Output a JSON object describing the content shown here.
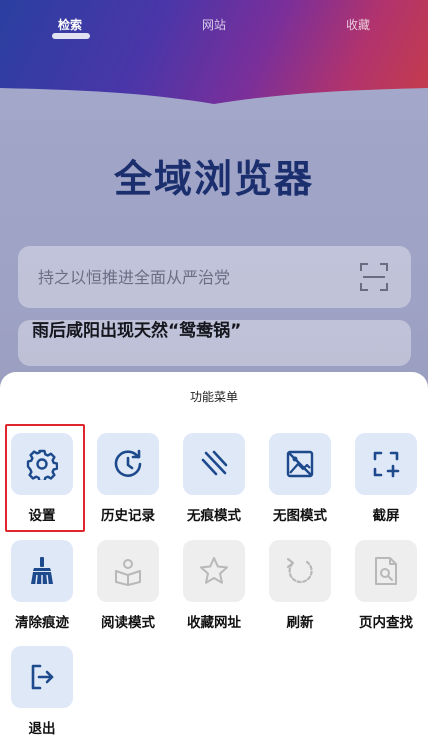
{
  "tabs": [
    {
      "label": "检索",
      "active": true
    },
    {
      "label": "网站",
      "active": false
    },
    {
      "label": "收藏",
      "active": false
    }
  ],
  "brand_title": "全域浏览器",
  "search": {
    "placeholder": "持之以恒推进全面从严治党",
    "scan_icon": "scan-icon"
  },
  "news_headline": "雨后咸阳出现天然“鸳鸯锅”",
  "menu": {
    "title": "功能菜单",
    "items": [
      {
        "label": "设置",
        "icon": "gear-icon",
        "enabled": true,
        "highlighted": true
      },
      {
        "label": "历史记录",
        "icon": "history-icon",
        "enabled": true
      },
      {
        "label": "无痕模式",
        "icon": "incognito-icon",
        "enabled": true
      },
      {
        "label": "无图模式",
        "icon": "no-image-icon",
        "enabled": true
      },
      {
        "label": "截屏",
        "icon": "screenshot-icon",
        "enabled": true
      },
      {
        "label": "清除痕迹",
        "icon": "broom-icon",
        "enabled": true
      },
      {
        "label": "阅读模式",
        "icon": "reader-icon",
        "enabled": false
      },
      {
        "label": "收藏网址",
        "icon": "star-icon",
        "enabled": false
      },
      {
        "label": "刷新",
        "icon": "refresh-icon",
        "enabled": false
      },
      {
        "label": "页内查找",
        "icon": "find-in-page-icon",
        "enabled": false
      },
      {
        "label": "退出",
        "icon": "exit-icon",
        "enabled": true
      }
    ]
  },
  "colors": {
    "brand_text": "#1b2f6e",
    "tile_enabled": "#dfe8f6",
    "tile_disabled": "#eeeeee",
    "icon_enabled": "#1d4a8c",
    "icon_disabled": "#b8b8b8",
    "highlight": "#e0262d"
  }
}
